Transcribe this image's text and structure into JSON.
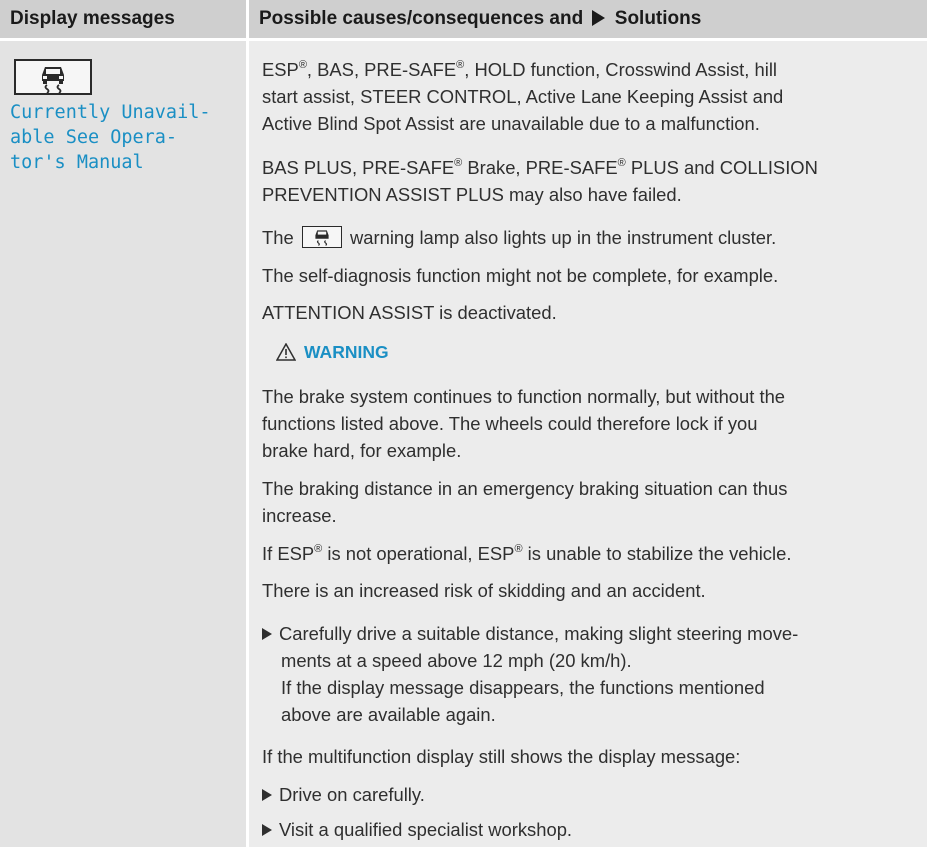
{
  "header": {
    "left": "Display messages",
    "right_prefix": "Possible causes/consequences and",
    "right_suffix": "Solutions"
  },
  "display_message": {
    "icon": "esp-skid-car-icon",
    "lines": [
      "Currently Unavail-",
      "able See Opera-",
      "tor's Manual"
    ]
  },
  "body": {
    "p1": [
      "ESP",
      "®",
      ", BAS, PRE-SAFE",
      "®",
      ", HOLD function, Crosswind Assist, hill"
    ],
    "p1_l2": "start assist, STEER CONTROL, Active Lane Keeping Assist and",
    "p1_l3": "Active Blind Spot Assist are unavailable due to a malfunction.",
    "p2_l1a": "BAS PLUS, PRE-SAFE",
    "p2_l1b": " Brake, PRE-SAFE",
    "p2_l1c": " PLUS and COLLISION",
    "p2_l2": "PREVENTION ASSIST PLUS may also have failed.",
    "p3_pre": "The",
    "p3_post": "warning lamp also lights up in the instrument cluster.",
    "p4": "The self-diagnosis function might not be complete, for example.",
    "p5": "ATTENTION ASSIST is deactivated.",
    "warning_title": "WARNING",
    "w1": "The brake system continues to function normally, but without the",
    "w2": "functions listed above. The wheels could therefore lock if you",
    "w3": "brake hard, for example.",
    "w4": "The braking distance in an emergency braking situation can thus",
    "w5": "increase.",
    "w6a": "If ESP",
    "w6b": " is not operational, ESP",
    "w6c": " is unable to stabilize the vehicle.",
    "w7": "There is an increased risk of skidding and an accident.",
    "s1": "Carefully drive a suitable distance, making slight steering move-",
    "s2": "ments at a speed above 12 mph (20 km/h).",
    "s3": "If the display message disappears, the functions mentioned",
    "s4": "above are available again.",
    "s5": "If the multifunction display still shows the display message:",
    "s6": "Drive on carefully.",
    "s7": "Visit a qualified specialist workshop.",
    "reg": "®"
  }
}
